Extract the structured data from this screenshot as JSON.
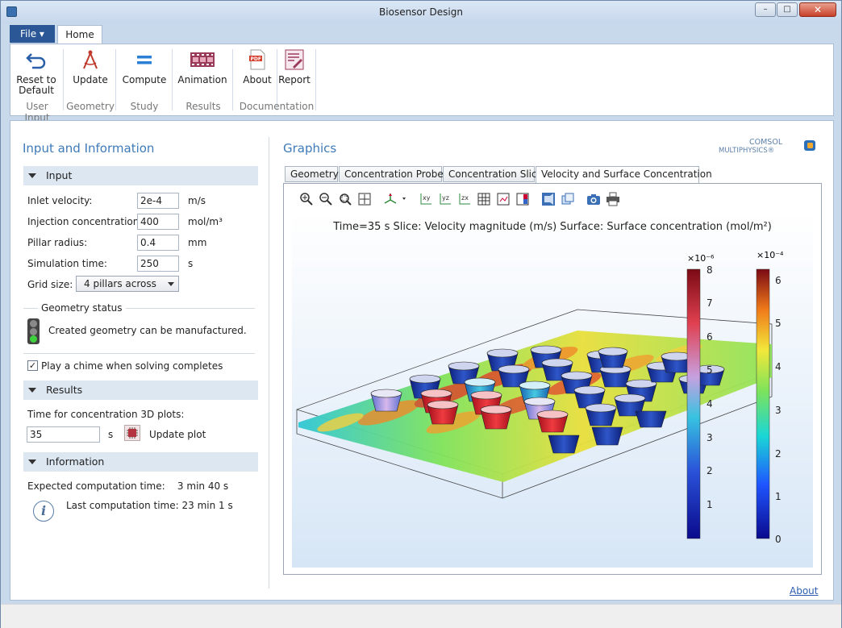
{
  "window": {
    "title": "Biosensor Design",
    "min_glyph": "–",
    "max_glyph": "□",
    "close_glyph": "✕"
  },
  "tabs": {
    "file": "File ▾",
    "home": "Home"
  },
  "ribbon": {
    "buttons": [
      {
        "label": "Reset to Default",
        "icon": "undo-arrow-icon"
      },
      {
        "label": "Update",
        "icon": "compass-geometry-icon"
      },
      {
        "label": "Compute",
        "icon": "equals-compute-icon"
      },
      {
        "label": "Animation",
        "icon": "film-strip-icon"
      },
      {
        "label": "About",
        "icon": "pdf-document-icon"
      },
      {
        "label": "Report",
        "icon": "report-icon"
      }
    ],
    "groups": [
      "User Input",
      "Geometry",
      "Study",
      "Results",
      "Documentation"
    ]
  },
  "left": {
    "title": "Input and Information",
    "input_section": "Input",
    "fields": [
      {
        "label": "Inlet velocity:",
        "value": "2e-4",
        "unit": "m/s"
      },
      {
        "label": "Injection concentration:",
        "value": "400",
        "unit": "mol/m³"
      },
      {
        "label": "Pillar radius:",
        "value": "0.4",
        "unit": "mm"
      },
      {
        "label": "Simulation time:",
        "value": "250",
        "unit": "s"
      }
    ],
    "grid_label": "Grid size:",
    "grid_value": "4 pillars across",
    "geometry_status_label": "Geometry status",
    "geometry_status_text": "Created geometry can be manufactured.",
    "chime_label": "Play a chime when solving completes",
    "chime_checked": true,
    "results_section": "Results",
    "time_label": "Time for concentration 3D plots:",
    "time_value": "35",
    "time_unit": "s",
    "update_plot": "Update plot",
    "information_section": "Information",
    "expected_time": "Expected computation time:    3 min 40 s",
    "last_time": "Last computation time: 23 min 1 s"
  },
  "graphics": {
    "title": "Graphics",
    "logo_line1": "COMSOL",
    "logo_line2": "MULTIPHYSICS®",
    "tabs": [
      "Geometry",
      "Concentration Probes",
      "Concentration Slice",
      "Velocity and Surface Concentration"
    ],
    "active_tab": 3,
    "toolbar_icons": [
      "zoom-in-icon",
      "zoom-out-icon",
      "zoom-box-icon",
      "zoom-extents-icon",
      "axis-orientation-icon",
      "xy-view-icon",
      "yz-view-icon",
      "zx-view-icon",
      "grid-icon",
      "scene-light-icon",
      "colorbar-icon",
      "transparency-icon",
      "wireframe-icon",
      "camera-icon",
      "print-icon"
    ],
    "plot_title": "Time=35 s   Slice: Velocity magnitude (m/s)  Surface: Surface concentration (mol/m²)"
  },
  "colorbars": [
    {
      "exponent": "×10⁻⁶",
      "ticks": [
        "8",
        "7",
        "6",
        "5",
        "4",
        "3",
        "2",
        "1"
      ]
    },
    {
      "exponent": "×10⁻⁴",
      "ticks": [
        "6",
        "5",
        "4",
        "3",
        "2",
        "1",
        "0"
      ]
    }
  ],
  "footer": {
    "about": "About"
  },
  "colors": {
    "accent": "#3e7bb8",
    "file_tab": "#2b5797",
    "section_bg": "#dde7f2"
  }
}
